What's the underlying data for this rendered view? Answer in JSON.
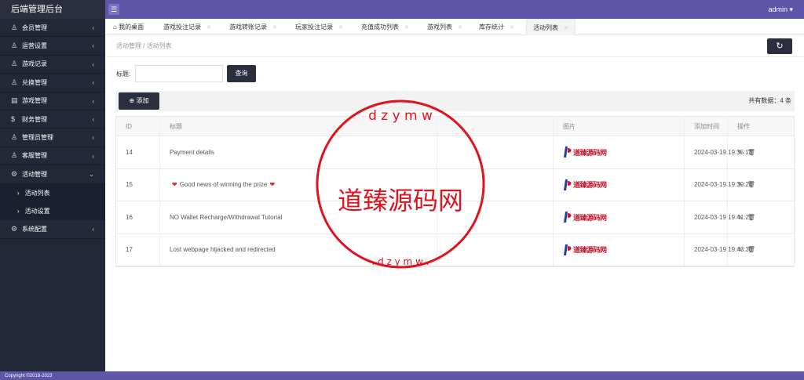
{
  "brand": "后端管理后台",
  "admin": "admin",
  "sidebar": {
    "items": [
      {
        "icon": "user-icon",
        "label": "会员管理"
      },
      {
        "icon": "user-icon",
        "label": "运营设置"
      },
      {
        "icon": "user-icon",
        "label": "游戏记录"
      },
      {
        "icon": "user-icon",
        "label": "兑换管理"
      },
      {
        "icon": "calendar-icon",
        "label": "游戏管理"
      },
      {
        "icon": "dollar-icon",
        "label": "财务管理"
      },
      {
        "icon": "users-icon",
        "label": "管理员管理"
      },
      {
        "icon": "user-icon",
        "label": "客服管理"
      },
      {
        "icon": "gear-icon",
        "label": "活动管理"
      }
    ],
    "sub": [
      "活动列表",
      "活动设置"
    ],
    "last": {
      "icon": "gear-icon",
      "label": "系统配置"
    }
  },
  "tabs": [
    "我的桌面",
    "游戏投注记录",
    "游戏转账记录",
    "玩家投注记录",
    "充值成功列表",
    "游戏列表",
    "库存统计",
    "活动列表"
  ],
  "breadcrumb": "活动管理 / 活动列表",
  "search": {
    "label": "标题:",
    "button": "查询"
  },
  "toolbar": {
    "add": "添加",
    "total": "共有数据：4 条"
  },
  "table": {
    "headers": [
      "ID",
      "标题",
      "",
      "图片",
      "添加时间",
      "操作"
    ],
    "rows": [
      {
        "id": "14",
        "title": "Payment details",
        "time": "2024-03-19 19:35:13"
      },
      {
        "id": "15",
        "title": "Good news of winning the prize",
        "time": "2024-03-19 19:39:24"
      },
      {
        "id": "16",
        "title": "NO Wallet Recharge/Withdrawal Tutorial",
        "time": "2024-03-19 19:41:21"
      },
      {
        "id": "17",
        "title": "Lost webpage hijacked and redirected",
        "time": "2024-03-19 19:43:30"
      }
    ],
    "pic_text": "道臻源码网"
  },
  "watermark": {
    "center": "道臻源码网",
    "ring": "dzym www.dzym.com",
    "color": "#e0141e"
  },
  "footer": "Copyright ©2018-2023"
}
